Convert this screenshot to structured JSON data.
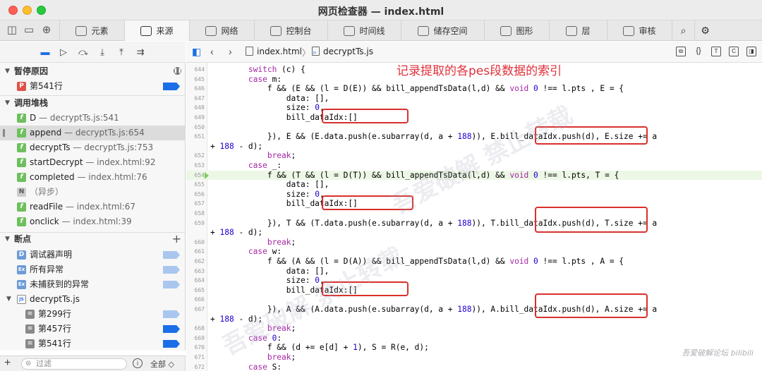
{
  "window": {
    "title": "网页检查器 — index.html"
  },
  "tabs": [
    {
      "label": "元素",
      "icon": "elements-icon"
    },
    {
      "label": "来源",
      "icon": "sources-icon",
      "active": true
    },
    {
      "label": "网络",
      "icon": "network-icon"
    },
    {
      "label": "控制台",
      "icon": "console-icon"
    },
    {
      "label": "时间线",
      "icon": "timeline-icon"
    },
    {
      "label": "储存空间",
      "icon": "storage-icon"
    },
    {
      "label": "图形",
      "icon": "graphics-icon"
    },
    {
      "label": "层",
      "icon": "layers-icon"
    },
    {
      "label": "审核",
      "icon": "audit-icon"
    }
  ],
  "sidebar": {
    "pause_reason": {
      "title": "暂停原因",
      "item": {
        "badge": "P",
        "label": "第541行"
      }
    },
    "call_stack": {
      "title": "调用堆栈",
      "frames": [
        {
          "badge": "f",
          "name": "D",
          "loc": " — decryptTs.js:541"
        },
        {
          "badge": "f",
          "name": "append",
          "loc": " — decryptTs.js:654",
          "selected": true
        },
        {
          "badge": "f",
          "name": "decryptTs",
          "loc": " — decryptTs.js:753"
        },
        {
          "badge": "f",
          "name": "startDecrypt",
          "loc": " — index.html:92"
        },
        {
          "badge": "f",
          "name": "completed",
          "loc": " — index.html:76"
        },
        {
          "badge": "N",
          "name": "（异步）",
          "loc": ""
        },
        {
          "badge": "f",
          "name": "readFile",
          "loc": " — index.html:67"
        },
        {
          "badge": "f",
          "name": "onclick",
          "loc": " — index.html:39"
        }
      ]
    },
    "breakpoints": {
      "title": "断点",
      "items": [
        {
          "badge": "D",
          "label": "调试器声明"
        },
        {
          "badge": "Ex",
          "label": "所有异常"
        },
        {
          "badge": "Ex",
          "label": "未捕获到的异常"
        },
        {
          "badge": "JS",
          "label": "decryptTs.js"
        },
        {
          "badge": "",
          "label": "第299行"
        },
        {
          "badge": "",
          "label": "第457行"
        },
        {
          "badge": "",
          "label": "第541行"
        }
      ]
    },
    "filter": {
      "placeholder": "过滤",
      "scope": "全部 ◇"
    }
  },
  "editor": {
    "breadcrumbs": [
      "index.html",
      "decryptTs.js"
    ],
    "annotation": "记录提取的各pes段数据的索引",
    "lines": [
      {
        "n": "644",
        "text": "        switch (c) {"
      },
      {
        "n": "645",
        "text": "        case m:"
      },
      {
        "n": "646",
        "text": "            f && (E && (l = D(E)) && bill_appendTsData(l,d) && void 0 !== l.pts , E = {"
      },
      {
        "n": "647",
        "text": "                data: [],"
      },
      {
        "n": "648",
        "text": "                size: 0,"
      },
      {
        "n": "649",
        "text": "                bill_dataIdx:[]"
      },
      {
        "n": "650",
        "text": ""
      },
      {
        "n": "651",
        "text": "            }), E && (E.data.push(e.subarray(d, a + 188)), E.bill_dataIdx.push(d), E.size += a"
      },
      {
        "n": "",
        "text": "+ 188 - d);"
      },
      {
        "n": "652",
        "text": "            break;"
      },
      {
        "n": "653",
        "text": "        case _:"
      },
      {
        "n": "654",
        "text": "            f && (T && (l = D(T)) && bill_appendTsData(l,d) && void 0 !== l.pts, T = {",
        "current": true
      },
      {
        "n": "655",
        "text": "                data: [],"
      },
      {
        "n": "656",
        "text": "                size: 0,"
      },
      {
        "n": "657",
        "text": "                bill_dataIdx:[]"
      },
      {
        "n": "658",
        "text": ""
      },
      {
        "n": "659",
        "text": "            }), T && (T.data.push(e.subarray(d, a + 188)), T.bill_dataIdx.push(d), T.size += a"
      },
      {
        "n": "",
        "text": "+ 188 - d);"
      },
      {
        "n": "660",
        "text": "            break;"
      },
      {
        "n": "661",
        "text": "        case w:"
      },
      {
        "n": "662",
        "text": "            f && (A && (l = D(A)) && bill_appendTsData(l,d) && void 0 !== l.pts , A = {"
      },
      {
        "n": "663",
        "text": "                data: [],"
      },
      {
        "n": "664",
        "text": "                size: 0,"
      },
      {
        "n": "665",
        "text": "                bill_dataIdx:[]"
      },
      {
        "n": "666",
        "text": ""
      },
      {
        "n": "667",
        "text": "            }), A && (A.data.push(e.subarray(d, a + 188)), A.bill_dataIdx.push(d), A.size += a"
      },
      {
        "n": "",
        "text": "+ 188 - d);"
      },
      {
        "n": "668",
        "text": "            break;"
      },
      {
        "n": "669",
        "text": "        case 0:"
      },
      {
        "n": "670",
        "text": "            f && (d += e[d] + 1), S = R(e, d);"
      },
      {
        "n": "671",
        "text": "            break;"
      },
      {
        "n": "672",
        "text": "        case S:"
      }
    ]
  },
  "watermark": {
    "text": "吾爱破解 禁止转载",
    "corner": "吾爱破解论坛 bilibili"
  },
  "colors": {
    "accent": "#1a6fe8",
    "annotation": "#e0303a",
    "current_line": "#edf7e6"
  }
}
